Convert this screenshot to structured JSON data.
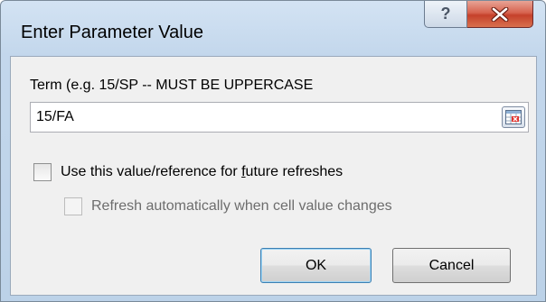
{
  "dialog": {
    "title": "Enter Parameter Value",
    "help_glyph": "?",
    "close_glyph": "X"
  },
  "prompt": {
    "label": "Term (e.g. 15/SP -- MUST BE UPPERCASE",
    "value": "15/FA"
  },
  "options": {
    "use_value": {
      "label_before": "Use this value/reference for ",
      "label_accel": "f",
      "label_after": "uture refreshes",
      "checked": false,
      "enabled": true
    },
    "refresh_auto": {
      "label": "Refresh automatically when cell value changes",
      "checked": false,
      "enabled": false
    }
  },
  "buttons": {
    "ok": "OK",
    "cancel": "Cancel"
  },
  "icons": {
    "help": "help-icon",
    "close": "close-icon",
    "reference": "range-reference-icon"
  },
  "colors": {
    "close_button": "#c5412b",
    "frame": "#c3d7ec",
    "client": "#f0f0f0"
  }
}
